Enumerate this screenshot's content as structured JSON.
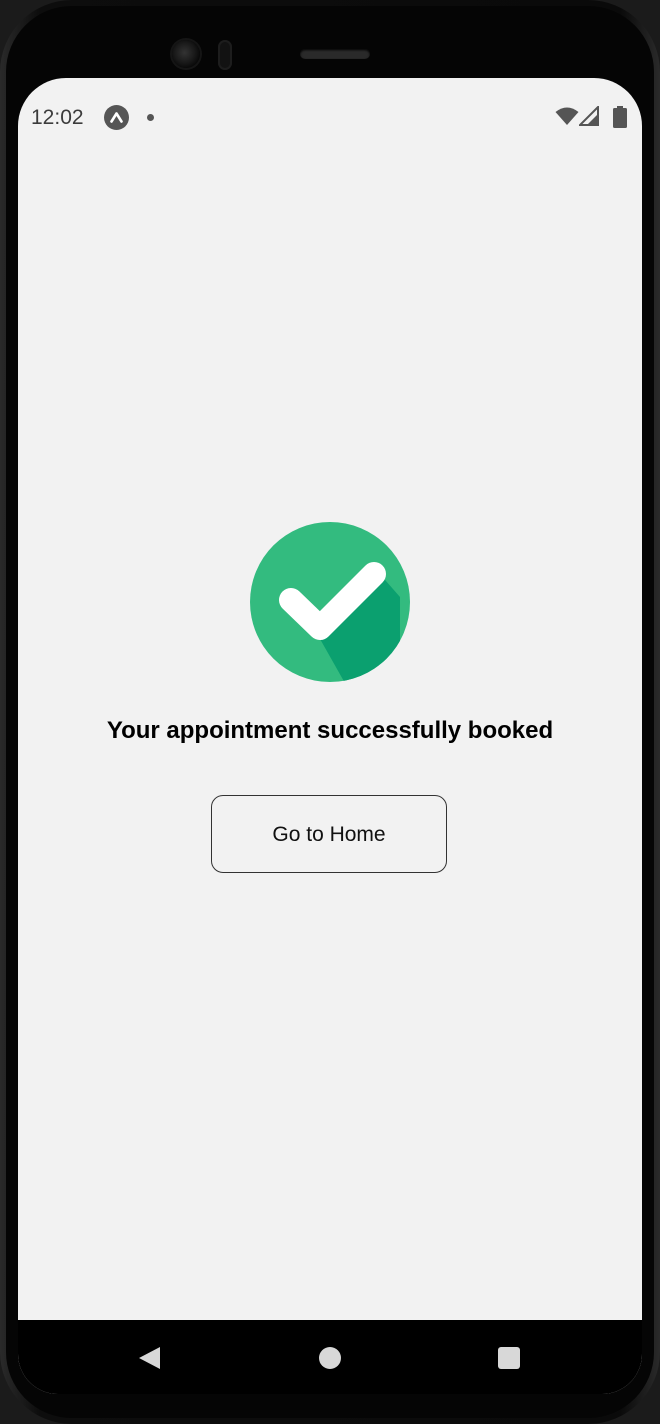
{
  "status_bar": {
    "time": "12:02",
    "app_icon": "expo-icon",
    "notification_dot": "dot-icon",
    "right_icons": [
      "wifi-icon",
      "signal-icon",
      "battery-icon"
    ]
  },
  "main": {
    "success_icon": "check-circle-icon",
    "success_color": "#33bb7f",
    "success_shadow_color": "#0ba06f",
    "message": "Your appointment successfully booked",
    "home_button_label": "Go to Home"
  },
  "nav_bar": {
    "items": [
      "back-icon",
      "home-icon",
      "recents-icon"
    ]
  }
}
